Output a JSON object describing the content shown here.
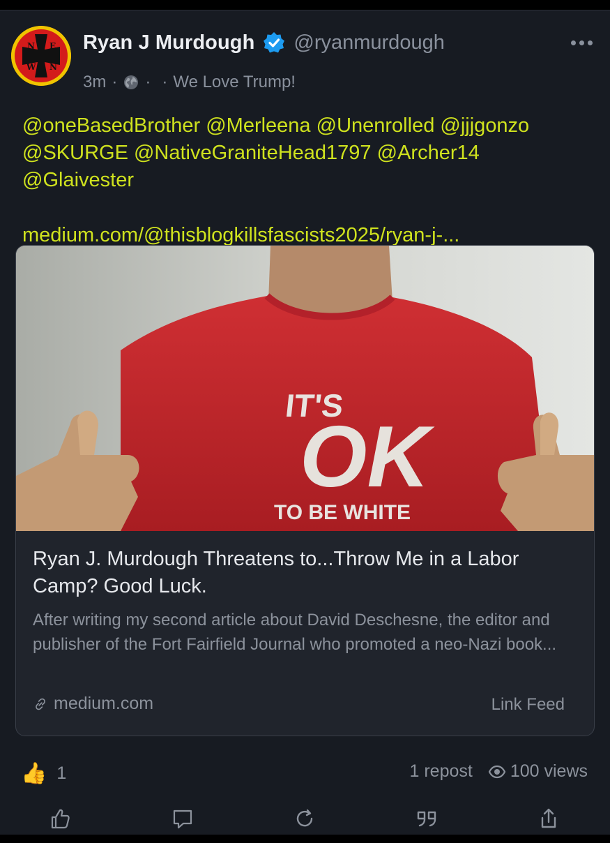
{
  "post": {
    "author": {
      "display_name": "Ryan J Murdough",
      "handle": "@ryanmurdough",
      "verified": true,
      "avatar_letters": [
        "N",
        "E",
        "W",
        "N"
      ]
    },
    "meta": {
      "time": "3m",
      "sep": "·",
      "visibility_icon": "globe-icon",
      "status": "We Love Trump!"
    },
    "mentions": [
      "@oneBasedBrother",
      "@Merleena",
      "@Unenrolled",
      "@jjjgonzo",
      "@SKURGE",
      "@NativeGraniteHead1797",
      "@Archer14",
      "@Glaivester"
    ],
    "link_text": "medium.com/@thisblogkillsfascists2025/ryan-j-...",
    "link_card": {
      "image_alt": "man in red shirt giving thumbs up",
      "image_text": {
        "line1": "IT'S",
        "line2": "OK",
        "line3": "TO BE WHITE"
      },
      "title": "Ryan J. Murdough Threatens to...Throw Me in a Labor Camp? Good Luck.",
      "description": "After writing my second article about David Deschesne, the editor and publisher of the Fort Fairfield Journal who promoted a neo-Nazi book...",
      "domain": "medium.com",
      "feed_label": "Link Feed"
    },
    "stats": {
      "like_emoji": "👍",
      "likes": "1",
      "reposts": "1 repost",
      "views": "100 views"
    },
    "actions": [
      "like-icon",
      "reply-icon",
      "repost-icon",
      "quote-icon",
      "share-icon"
    ]
  },
  "colors": {
    "background": "#171b22",
    "accent_text": "#cfe21e",
    "muted": "#8a919d",
    "verified": "#1d9bf0",
    "shirt": "#c9262c"
  }
}
